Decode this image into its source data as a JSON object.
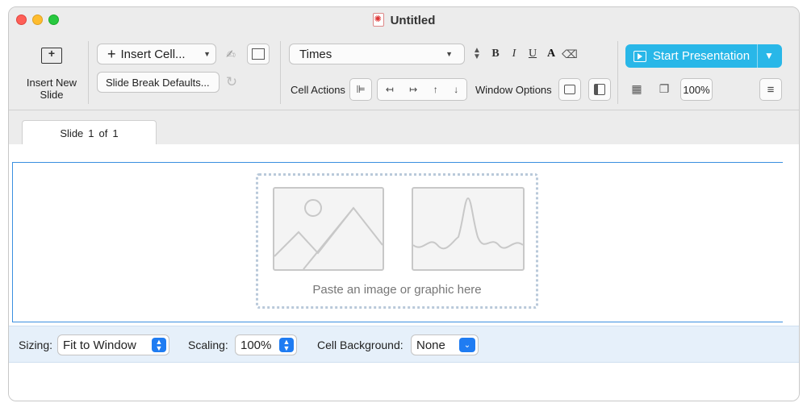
{
  "window": {
    "title": "Untitled"
  },
  "toolbar": {
    "insert_new_slide_label": "Insert New Slide",
    "insert_cell_label": "Insert Cell...",
    "slide_break_label": "Slide Break Defaults...",
    "font_name": "Times",
    "bold": "B",
    "italic": "I",
    "underline": "U",
    "text_color": "A",
    "cell_actions_label": "Cell Actions",
    "window_options_label": "Window Options",
    "start_presentation_label": "Start Presentation",
    "zoom": "100%"
  },
  "tab": {
    "prefix": "Slide",
    "current": "1",
    "of": "of",
    "total": "1"
  },
  "dropzone": {
    "label": "Paste an image or graphic here"
  },
  "bottom": {
    "sizing_label": "Sizing:",
    "sizing_value": "Fit to Window",
    "scaling_label": "Scaling:",
    "scaling_value": "100%",
    "background_label": "Cell Background:",
    "background_value": "None"
  },
  "colors": {
    "accent": "#29b7e8",
    "selection": "#3a8fe0",
    "control_blue": "#1f7cf2"
  }
}
